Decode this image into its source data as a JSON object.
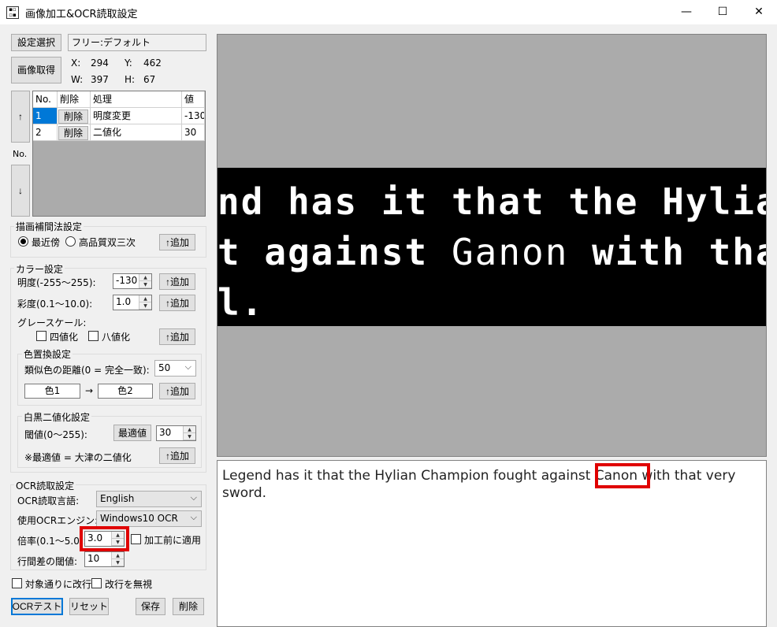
{
  "window": {
    "title": "画像加工&OCR読取設定",
    "minimize": "—",
    "maximize": "☐",
    "close": "✕"
  },
  "top": {
    "select_btn": "設定選択",
    "preset": "フリー:デフォルト",
    "capture_btn": "画像取得",
    "x_label": "X:",
    "x_val": "294",
    "y_label": "Y:",
    "y_val": "462",
    "w_label": "W:",
    "w_val": "397",
    "h_label": "H:",
    "h_val": "67"
  },
  "order": {
    "up": "↑",
    "no": "No.",
    "down": "↓"
  },
  "grid": {
    "headers": [
      "No.",
      "削除",
      "処理",
      "値"
    ],
    "rows": [
      {
        "no": "1",
        "del": "削除",
        "proc": "明度変更",
        "val": "-130"
      },
      {
        "no": "2",
        "del": "削除",
        "proc": "二値化",
        "val": "30"
      }
    ]
  },
  "interp": {
    "title": "描画補間法設定",
    "opt1": "最近傍",
    "opt2": "高品質双三次",
    "add": "↑追加"
  },
  "color": {
    "title": "カラー設定",
    "brightness_label": "明度(-255〜255):",
    "brightness_val": "-130",
    "saturation_label": "彩度(0.1〜10.0):",
    "saturation_val": "1.0",
    "gray_label": "グレースケール:",
    "gray4": "四値化",
    "gray8": "八値化",
    "add": "↑追加",
    "replace_title": "色置換設定",
    "distance_label": "類似色の距離(0 = 完全一致):",
    "distance_val": "50",
    "color1": "色1",
    "arrow": "→",
    "color2": "色2",
    "bw_title": "白黒二値化設定",
    "threshold_label": "閾値(0〜255):",
    "optimal_btn": "最適値",
    "threshold_val": "30",
    "note": "※最適値 = 大津の二値化"
  },
  "ocr": {
    "title": "OCR読取設定",
    "lang_label": "OCR読取言語:",
    "lang_val": "English",
    "engine_label": "使用OCRエンジン:",
    "engine_val": "Windows10 OCR",
    "scale_label": "倍率(0.1〜5.0):",
    "scale_val": "3.0",
    "apply_before": "加工前に適用",
    "line_label": "行間差の閾値:",
    "line_val": "10"
  },
  "options": {
    "linebreak": "対象通りに改行",
    "ignore_break": "改行を無視"
  },
  "buttons": {
    "ocr_test": "OCRテスト",
    "reset": "リセット",
    "save": "保存",
    "delete": "削除"
  },
  "preview": {
    "line1": "nd has it that the Hylian Cham",
    "line2a": "t against ",
    "line2b": "Ganon",
    "line2c": " with that ver",
    "line3": "l."
  },
  "result": {
    "text": "Legend has it that the Hylian Champion fought against Canon with that very sword."
  },
  "colors": {
    "highlight": "#e00000",
    "accent": "#0078d7"
  }
}
